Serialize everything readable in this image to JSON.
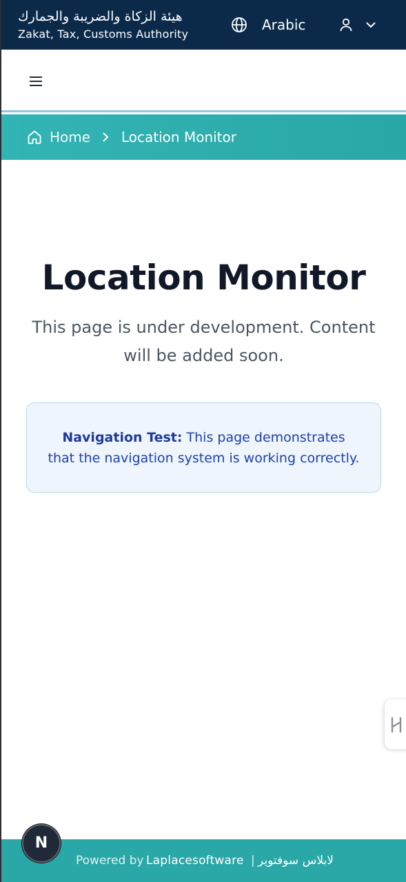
{
  "header": {
    "brand_arabic": "هيئة الزكاة والضريبة والجمارك",
    "brand_english": "Zakat, Tax, Customs Authority",
    "language_label": "Arabic"
  },
  "breadcrumb": {
    "home_label": "Home",
    "current_label": "Location Monitor"
  },
  "main": {
    "title": "Location Monitor",
    "subtitle": "This page is under development. Content will be added soon.",
    "notice_label": "Navigation Test:",
    "notice_text": " This page demonstrates that the navigation system is working correctly."
  },
  "footer": {
    "powered_by": "Powered by",
    "company": "Laplacesoftware",
    "separator": "|",
    "company_arabic": "لابلاس سوفتوير"
  },
  "badge": {
    "letter": "N"
  },
  "colors": {
    "header_bg": "#0b2a4a",
    "teal": "#2aa7a7",
    "notice_bg": "#eef5fd",
    "notice_text": "#1e40af",
    "title": "#111827"
  }
}
